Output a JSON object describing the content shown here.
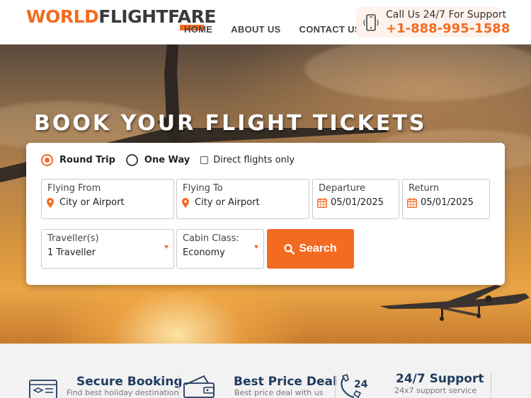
{
  "brand": {
    "logo_world": "W",
    "logo_orld": "ORLD",
    "logo_rest": "FLIGHTFARE",
    "accent_color": "#f26b21",
    "dark_color": "#1f3a5f"
  },
  "nav": {
    "items": [
      "HOME",
      "ABOUT US",
      "CONTACT US"
    ]
  },
  "support": {
    "label": "Call Us 24/7 For Support",
    "phone": "+1-888-995-1588",
    "icon": "mobile-phone-icon"
  },
  "hero": {
    "title": "BOOK YOUR FLIGHT TICKETS"
  },
  "search": {
    "trip_types": [
      {
        "label": "Round Trip",
        "selected": true
      },
      {
        "label": "One Way",
        "selected": false
      }
    ],
    "direct_only": {
      "label": "Direct flights only",
      "checked": false
    },
    "flying_from": {
      "label": "Flying From",
      "placeholder": "City or Airport",
      "icon": "map-pin-icon"
    },
    "flying_to": {
      "label": "Flying To",
      "placeholder": "City or Airport",
      "icon": "map-pin-icon"
    },
    "departure": {
      "label": "Departure",
      "value": "05/01/2025",
      "icon": "calendar-icon"
    },
    "return": {
      "label": "Return",
      "value": "05/01/2025",
      "icon": "calendar-icon"
    },
    "travellers": {
      "label": "Traveller(s)",
      "value": "1 Traveller"
    },
    "cabin": {
      "label": "Cabin Class:",
      "value": "Economy"
    },
    "button_label": "Search",
    "button_icon": "search-icon"
  },
  "features": [
    {
      "title": "Secure Booking",
      "subtitle": "Find best holiday destination",
      "icon": "secure-booking-icon"
    },
    {
      "title": "Best Price Deal",
      "subtitle": "Best price deal with us",
      "icon": "wallet-icon"
    },
    {
      "title": "24/7 Support",
      "subtitle": "24x7 support service",
      "icon": "support-24-icon"
    }
  ]
}
